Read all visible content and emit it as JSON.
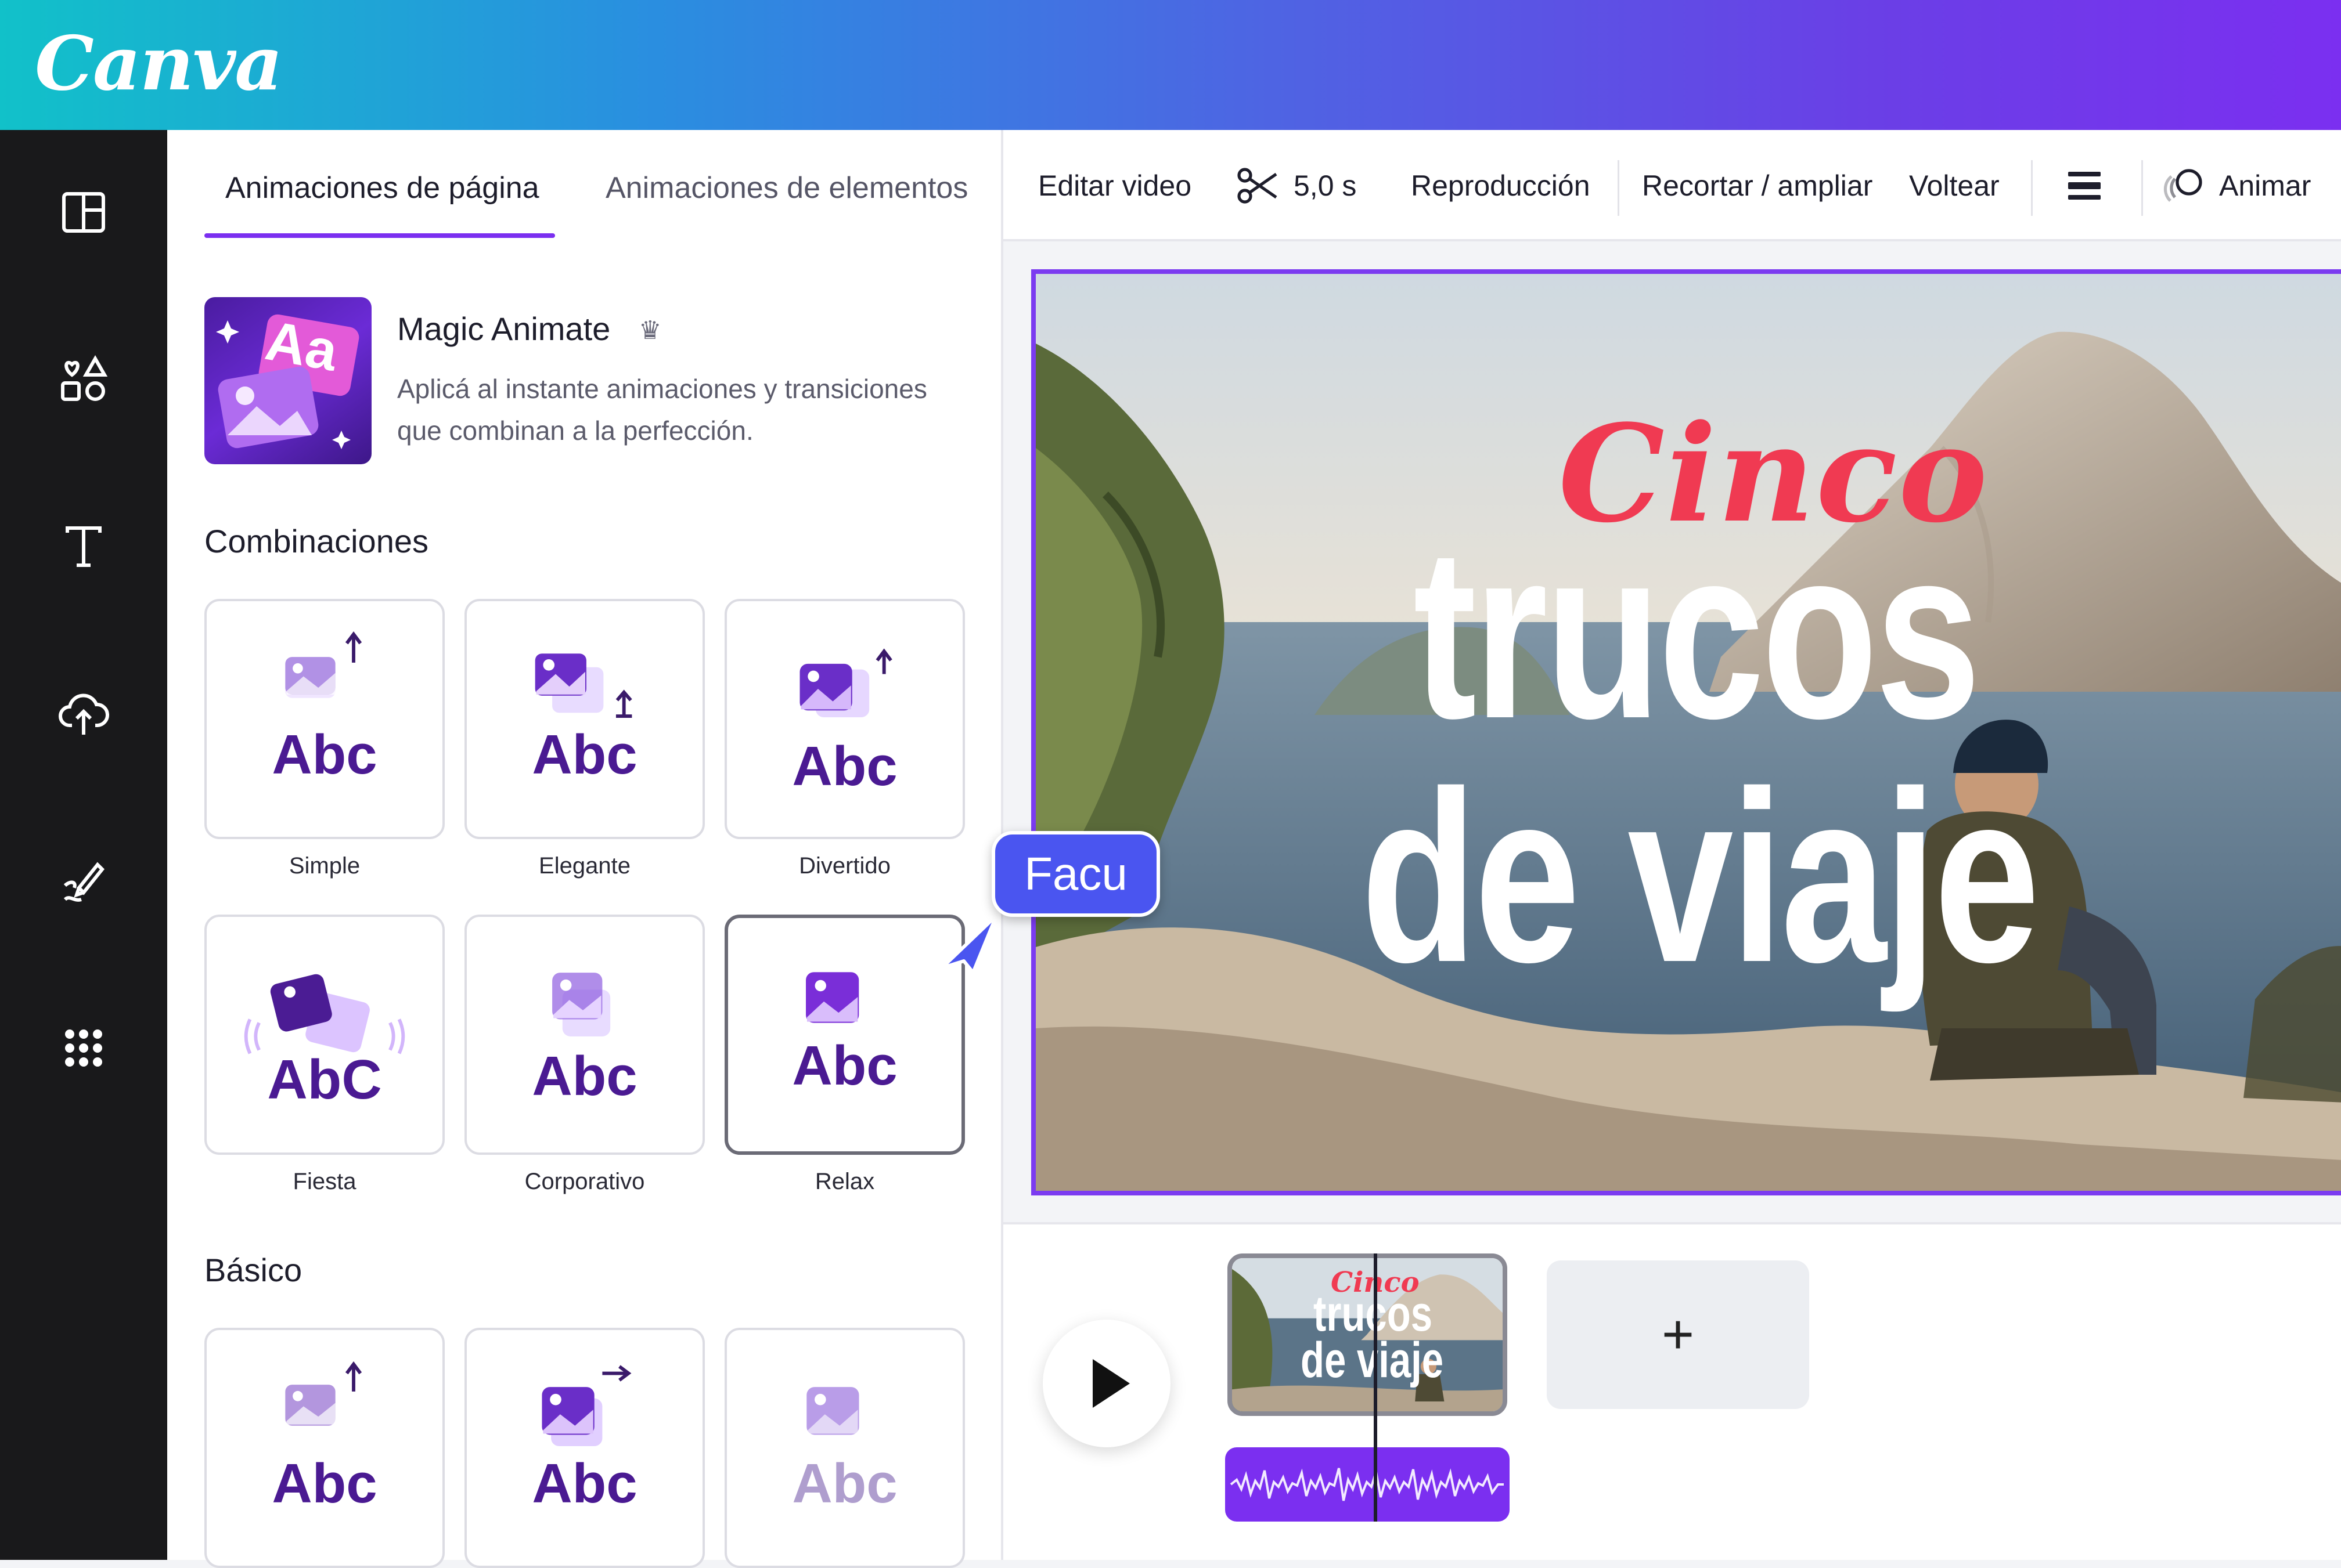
{
  "header": {
    "logo": "Canva"
  },
  "rail": {
    "items": [
      {
        "icon": "layout-icon"
      },
      {
        "icon": "elements-icon"
      },
      {
        "icon": "text-icon"
      },
      {
        "icon": "upload-icon"
      },
      {
        "icon": "draw-icon"
      },
      {
        "icon": "apps-icon"
      }
    ]
  },
  "panel": {
    "tabs": [
      "Animaciones de página",
      "Animaciones de elementos"
    ],
    "active_tab": 0,
    "magic": {
      "thumb_text": "Aa",
      "title": "Magic Animate",
      "description": "Aplicá al instante animaciones y transiciones que combinan a la perfección."
    },
    "sections": [
      {
        "title": "Combinaciones",
        "cards": [
          {
            "label": "Simple",
            "abc": "Abc"
          },
          {
            "label": "Elegante",
            "abc": "Abc"
          },
          {
            "label": "Divertido",
            "abc": "Abc"
          },
          {
            "label": "Fiesta",
            "abc": "AbC"
          },
          {
            "label": "Corporativo",
            "abc": "Abc"
          },
          {
            "label": "Relax",
            "abc": "Abc",
            "selected": true
          }
        ]
      },
      {
        "title": "Básico",
        "cards": [
          {
            "abc": "Abc"
          },
          {
            "abc": "Abc"
          },
          {
            "abc": "Abc"
          }
        ]
      }
    ]
  },
  "toolbar": {
    "edit_video": "Editar video",
    "duration": "5,0 s",
    "playback": "Reproducción",
    "crop": "Recortar / ampliar",
    "flip": "Voltear",
    "animate": "Animar"
  },
  "canvas": {
    "line1": "Cinco",
    "line2": "trucos",
    "line3": "de viaje"
  },
  "collaborator": {
    "name": "Facu"
  },
  "timeline": {
    "add_label": "+",
    "clip_line1": "Cinco",
    "clip_line2": "trucos",
    "clip_line3": "de viaje"
  },
  "colors": {
    "accent": "#7b2ff0",
    "title_red": "#f03a52",
    "collaborator": "#4a55f0"
  }
}
